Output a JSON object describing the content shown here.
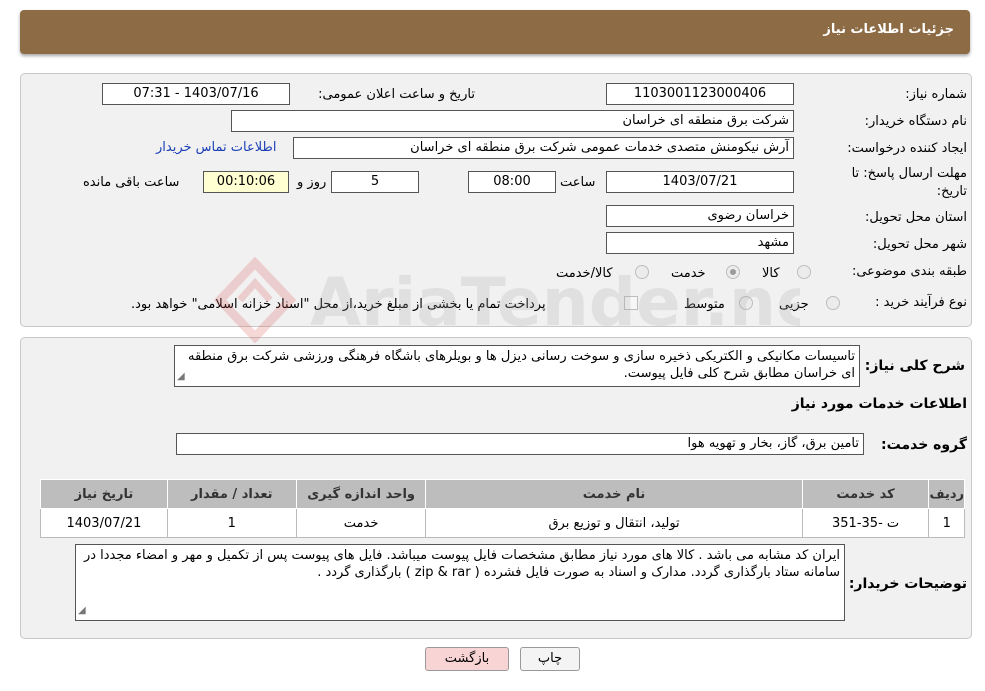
{
  "header": {
    "title": "جزئیات اطلاعات نیاز"
  },
  "form": {
    "need_number_label": "شماره نیاز:",
    "need_number": "1103001123000406",
    "announce_label": "تاریخ و ساعت اعلان عمومی:",
    "announce_value": "1403/07/16 - 07:31",
    "buyer_org_label": "نام دستگاه خریدار:",
    "buyer_org": "شرکت برق منطقه ای خراسان",
    "creator_label": "ایجاد کننده درخواست:",
    "creator": "آرش نیکومنش متصدی خدمات عمومی شرکت برق منطقه ای خراسان",
    "contact_link": "اطلاعات تماس خریدار",
    "deadline_label": "مهلت ارسال پاسخ: تا تاریخ:",
    "deadline_date": "1403/07/21",
    "hour_label": "ساعت",
    "deadline_time": "08:00",
    "days_value": "5",
    "days_label": "روز و",
    "remaining_time": "00:10:06",
    "remaining_label": "ساعت باقی مانده",
    "province_label": "استان محل تحویل:",
    "province": "خراسان رضوی",
    "city_label": "شهر محل تحویل:",
    "city": "مشهد",
    "category_label": "طبقه بندی موضوعی:",
    "category_options": [
      "کالا",
      "خدمت",
      "کالا/خدمت"
    ],
    "purchase_type_label": "نوع فرآیند خرید :",
    "purchase_options": [
      "جزیی",
      "متوسط"
    ],
    "payment_note": "پرداخت تمام یا بخشی از مبلغ خرید،از محل \"اسناد خزانه اسلامی\" خواهد بود."
  },
  "summary": {
    "label": "شرح کلی نیاز:",
    "text": "تاسیسات مکانیکی و الکتریکی ذخیره سازی و سوخت رسانی دیزل ها و بویلرهای باشگاه فرهنگی ورزشی شرکت برق منطقه ای خراسان مطابق شرح کلی فایل پیوست.",
    "services_title": "اطلاعات خدمات مورد نیاز",
    "service_group_label": "گروه خدمت:",
    "service_group": "تامین برق، گاز، بخار و تهویه هوا"
  },
  "table": {
    "headers": [
      "ردیف",
      "کد خدمت",
      "نام خدمت",
      "واحد اندازه گیری",
      "تعداد / مقدار",
      "تاریخ نیاز"
    ],
    "rows": [
      [
        "1",
        "ت -35-351",
        "تولید، انتقال و توزیع برق",
        "خدمت",
        "1",
        "1403/07/21"
      ]
    ]
  },
  "buyer_notes": {
    "label": "توضیحات خریدار:",
    "text": "ایران کد مشابه می باشد . کالا های مورد نیاز مطابق مشخصات فایل پیوست میباشد. فایل های پیوست پس از تکمیل و مهر و امضاء مجددا در سامانه ستاد بارگذاری گردد. مدارک و اسناد به صورت فایل فشرده ( zip & rar ) بارگذاری گردد ."
  },
  "buttons": {
    "print": "چاپ",
    "back": "بازگشت"
  },
  "watermark": {
    "text": "AriaTender.neT"
  },
  "colors": {
    "header": "#8d6b45",
    "link": "#1a3fb5",
    "back_button": "#f9d4d4"
  }
}
